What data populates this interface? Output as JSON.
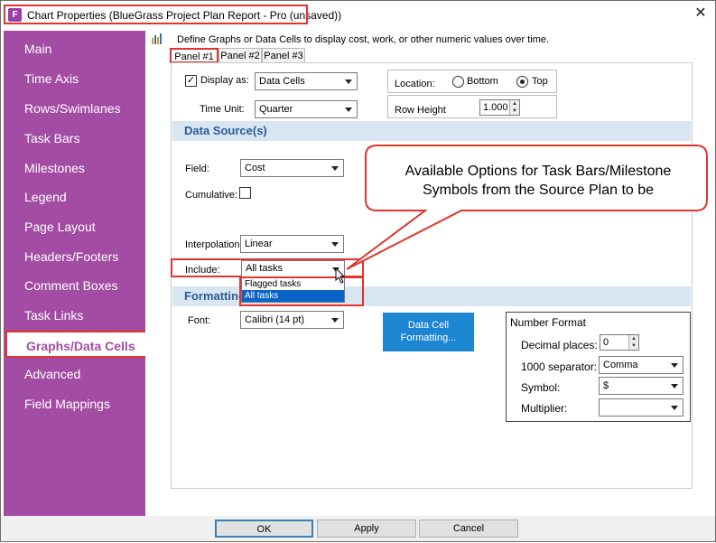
{
  "window": {
    "title": "Chart Properties (BlueGrass Project Plan Report - Pro (unsaved))",
    "icon_letter": "F",
    "close": "✕"
  },
  "sidebar": {
    "items": [
      {
        "label": "Main"
      },
      {
        "label": "Time Axis"
      },
      {
        "label": "Rows/Swimlanes"
      },
      {
        "label": "Task Bars"
      },
      {
        "label": "Milestones"
      },
      {
        "label": "Legend"
      },
      {
        "label": "Page Layout"
      },
      {
        "label": "Headers/Footers"
      },
      {
        "label": "Comment Boxes"
      },
      {
        "label": "Task Links"
      },
      {
        "label": "Graphs/Data Cells"
      },
      {
        "label": "Advanced"
      },
      {
        "label": "Field Mappings"
      }
    ],
    "active_index": 10
  },
  "description": "Define Graphs or Data Cells to display cost, work, or other numeric values over time.",
  "tabs": [
    {
      "label": "Panel #1",
      "selected": true
    },
    {
      "label": "Panel #2",
      "selected": false
    },
    {
      "label": "Panel #3",
      "selected": false
    }
  ],
  "panel": {
    "display_as_label": "Display as:",
    "display_as_checked": true,
    "display_as_value": "Data Cells",
    "location_label": "Location:",
    "location_bottom": "Bottom",
    "location_top": "Top",
    "location_selected": "Top",
    "time_unit_label": "Time Unit:",
    "time_unit_value": "Quarter",
    "row_height_label": "Row Height",
    "row_height_value": "1.000",
    "data_source_heading": "Data Source(s)",
    "field_label": "Field:",
    "field_value": "Cost",
    "cumulative_label": "Cumulative:",
    "cumulative_checked": false,
    "interpolation_label": "Interpolation:",
    "interpolation_value": "Linear",
    "include_label": "Include:",
    "include_value": "All tasks",
    "include_options": [
      "Flagged tasks",
      "All tasks"
    ],
    "include_highlighted": "All tasks",
    "formatting_heading": "Formatting",
    "font_label": "Font:",
    "font_value": "Calibri (14 pt)",
    "data_cell_button": "Data Cell Formatting...",
    "number_format": {
      "title": "Number Format",
      "decimal_label": "Decimal places:",
      "decimal_value": "0",
      "separator_label": "1000 separator:",
      "separator_value": "Comma",
      "symbol_label": "Symbol:",
      "symbol_value": "$",
      "multiplier_label": "Multiplier:",
      "multiplier_value": ""
    }
  },
  "callout": {
    "line1": "Available Options for Task Bars/Milestone",
    "line2": "Symbols from the Source Plan to be"
  },
  "footer": {
    "ok": "OK",
    "apply": "Apply",
    "cancel": "Cancel"
  },
  "colors": {
    "sidebar": "#a34ca3",
    "highlight_red": "#e0342e",
    "section_bg": "#d9e6f2",
    "button_blue": "#1c86d3"
  }
}
